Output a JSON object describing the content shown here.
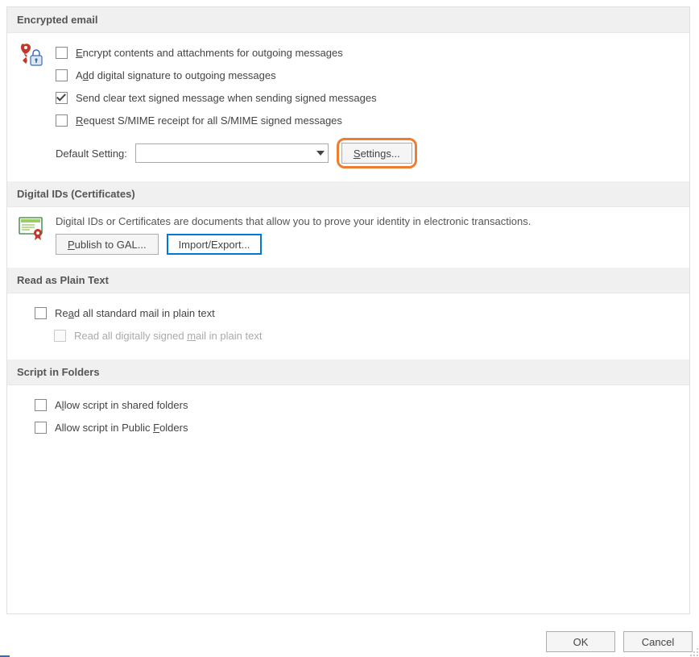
{
  "sections": {
    "encrypted": {
      "title": "Encrypted email",
      "opt1": {
        "pre": "E",
        "rest": "ncrypt contents and attachments for outgoing messages",
        "checked": false
      },
      "opt2": {
        "pre": "A",
        "mid": "d",
        "rest": "d digital signature to outgoing messages",
        "checked": false
      },
      "opt3": {
        "label": "Send clear text signed message when sending signed messages",
        "checked": true
      },
      "opt4": {
        "pre": "R",
        "rest": "equest S/MIME receipt for all S/MIME signed messages",
        "checked": false
      },
      "defaultLabel": "Default Setting:",
      "defaultValue": "",
      "settingsBtn": {
        "pre": "S",
        "rest": "ettings..."
      }
    },
    "digital": {
      "title": "Digital IDs (Certificates)",
      "desc": "Digital IDs or Certificates are documents that allow you to prove your identity in electronic transactions.",
      "publishBtn": {
        "pre": "P",
        "rest": "ublish to GAL..."
      },
      "importBtn": {
        "label": "Import/Export..."
      }
    },
    "plain": {
      "title": "Read as Plain Text",
      "opt1": {
        "pre": "Re",
        "mid": "a",
        "rest": "d all standard mail in plain text",
        "checked": false
      },
      "opt2": {
        "pre": "Read all digitally signed ",
        "mid": "m",
        "rest": "ail in plain text",
        "checked": false,
        "disabled": true
      }
    },
    "script": {
      "title": "Script in Folders",
      "opt1": {
        "pre": "A",
        "mid": "l",
        "rest": "low script in shared folders",
        "checked": false
      },
      "opt2": {
        "pre": "Allow script in Public ",
        "mid": "F",
        "rest": "olders",
        "checked": false
      }
    }
  },
  "footer": {
    "ok": "OK",
    "cancel": "Cancel"
  }
}
